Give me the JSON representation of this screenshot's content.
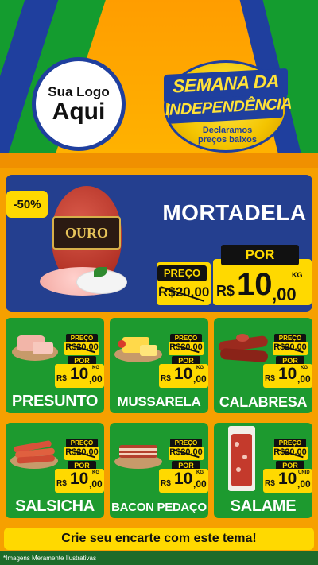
{
  "header": {
    "logo_line1": "Sua Logo",
    "logo_line2": "Aqui",
    "seal_line1": "SEMANA DA",
    "seal_line2": "INDEPENDÊNCIA",
    "seal_tagline1": "Declaramos",
    "seal_tagline2": "preços baixos"
  },
  "featured": {
    "discount": "-50%",
    "brand": "OURO",
    "name": "MORTADELA",
    "preco_label": "PREÇO",
    "old_price": "R$20,00",
    "por_label": "POR",
    "currency": "R$",
    "price_int": "10",
    "price_dec": ",00",
    "unit": "KG"
  },
  "products": [
    {
      "name": "PRESUNTO",
      "preco_label": "PREÇO",
      "old_price": "R$20,00",
      "por_label": "POR",
      "currency": "R$",
      "price_int": "10",
      "price_dec": ",00",
      "unit": "KG"
    },
    {
      "name": "MUSSARELA",
      "preco_label": "PREÇO",
      "old_price": "R$20,00",
      "por_label": "POR",
      "currency": "R$",
      "price_int": "10",
      "price_dec": ",00",
      "unit": "KG"
    },
    {
      "name": "CALABRESA",
      "preco_label": "PREÇO",
      "old_price": "R$20,00",
      "por_label": "POR",
      "currency": "R$",
      "price_int": "10",
      "price_dec": ",00",
      "unit": "KG"
    },
    {
      "name": "SALSICHA",
      "preco_label": "PREÇO",
      "old_price": "R$20,00",
      "por_label": "POR",
      "currency": "R$",
      "price_int": "10",
      "price_dec": ",00",
      "unit": "KG"
    },
    {
      "name": "BACON PEDAÇO",
      "preco_label": "PREÇO",
      "old_price": "R$20,00",
      "por_label": "POR",
      "currency": "R$",
      "price_int": "10",
      "price_dec": ",00",
      "unit": "KG"
    },
    {
      "name": "SALAME",
      "preco_label": "PREÇO",
      "old_price": "R$20,00",
      "por_label": "POR",
      "currency": "R$",
      "price_int": "10",
      "price_dec": ",00",
      "unit": "UNID"
    }
  ],
  "cta": "Crie seu encarte com este tema!",
  "footnote": "*Imagens Meramente Ilustrativas",
  "colors": {
    "green": "#1d9a2f",
    "blue": "#243f8f",
    "orange": "#f6a000",
    "yellow": "#ffd900"
  }
}
